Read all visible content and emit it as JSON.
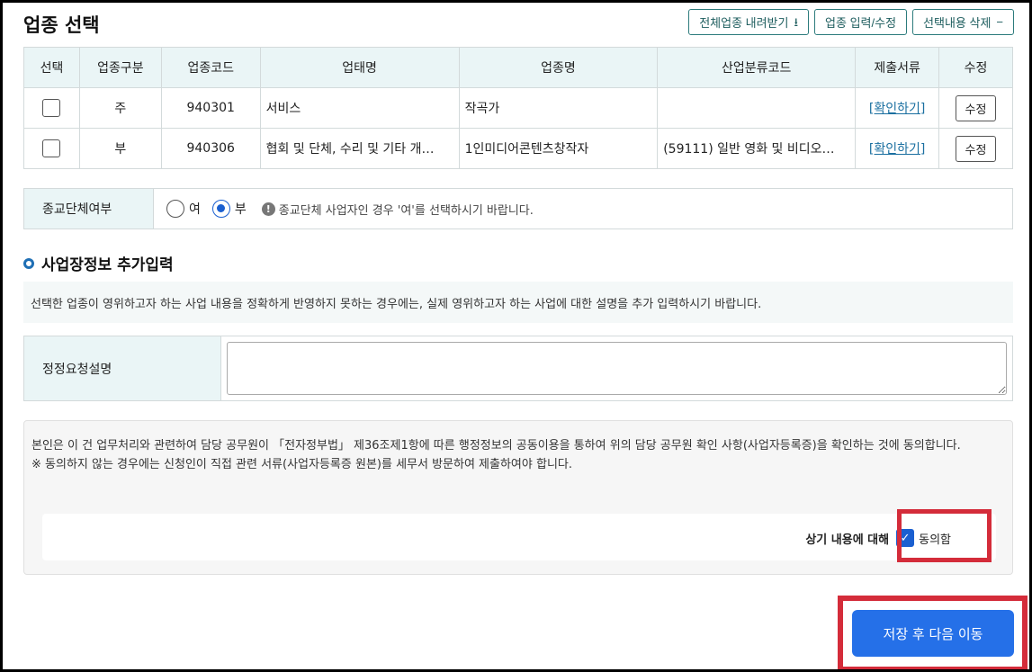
{
  "header": {
    "title": "업종 선택",
    "buttons": {
      "download": "전체업종 내려받기",
      "input": "업종 입력/수정",
      "delete": "선택내용 삭제"
    }
  },
  "table": {
    "columns": [
      "선택",
      "업종구분",
      "업종코드",
      "업태명",
      "업종명",
      "산업분류코드",
      "제출서류",
      "수정"
    ],
    "rows": [
      {
        "type": "주",
        "code": "940301",
        "business": "서비스",
        "industry": "작곡가",
        "class_code": "",
        "doc_link": "[확인하기]",
        "edit": "수정",
        "checked": false
      },
      {
        "type": "부",
        "code": "940306",
        "business": "협회 및 단체, 수리 및 기타 개…",
        "industry": "1인미디어콘텐츠창작자",
        "class_code": "(59111) 일반 영화 및 비디오…",
        "doc_link": "[확인하기]",
        "edit": "수정",
        "checked": false
      }
    ]
  },
  "religion": {
    "label": "종교단체여부",
    "options": [
      "여",
      "부"
    ],
    "selected": "부",
    "hint": "종교단체 사업자인 경우 '여'를 선택하시기 바랍니다."
  },
  "section": {
    "title": "사업장정보 추가입력",
    "description": "선택한 업종이 영위하고자 하는 사업 내용을 정확하게 반영하지 못하는 경우에는, 실제 영위하고자 하는 사업에 대한 설명을 추가 입력하시기 바랍니다.",
    "request_label": "정정요청설명",
    "request_value": ""
  },
  "consent": {
    "text1": "본인은 이 건 업무처리와 관련하여 담당 공무원이 「전자정부법」 제36조제1항에 따른 행정정보의 공동이용을 통하여 위의 담당 공무원 확인 사항(사업자등록증)을 확인하는 것에 동의합니다.",
    "text2": "※  동의하지 않는 경우에는 신청인이 직접 관련 서류(사업자등록증 원본)를 세무서 방문하여 제출하여야 합니다.",
    "agree_prefix": "상기 내용에 대해",
    "agree_label": "동의함",
    "agreed": true
  },
  "footer": {
    "save_button": "저장 후 다음 이동"
  },
  "colors": {
    "accent": "#2570e8",
    "highlight": "#d42c3a",
    "header_bg": "#eaf5f6"
  }
}
